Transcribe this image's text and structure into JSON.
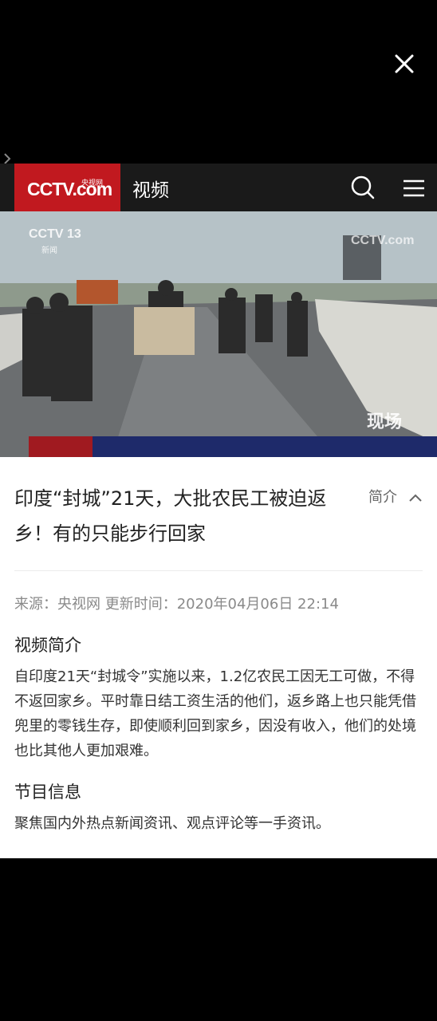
{
  "header": {
    "logo_text": "CCTV.com",
    "logo_cn": "央视网",
    "title": "视频"
  },
  "video": {
    "watermark_left": "CCTV 13",
    "watermark_left_sub": "新闻",
    "watermark_right": "CCTV.com",
    "corner_logo": "现场"
  },
  "article": {
    "title": "印度“封城”21天，大批农民工被迫返乡！有的只能步行回家",
    "intro_toggle": "简介",
    "meta": "来源：央视网 更新时间：2020年04月06日 22:14",
    "section1_title": "视频简介",
    "section1_text": "自印度21天“封城令”实施以来，1.2亿农民工因无工可做，不得不返回家乡。平时靠日结工资生活的他们，返乡路上也只能凭借兜里的零钱生存，即使顺利回到家乡，因没有收入，他们的处境也比其他人更加艰难。",
    "section2_title": "节目信息",
    "section2_text": "聚焦国内外热点新闻资讯、观点评论等一手资讯。"
  },
  "colors": {
    "brand_red": "#c1191f",
    "header_bg": "#1a1a1a"
  },
  "icons": [
    "close-icon",
    "chevron-right-icon",
    "search-icon",
    "menu-icon",
    "chevron-up-icon"
  ]
}
